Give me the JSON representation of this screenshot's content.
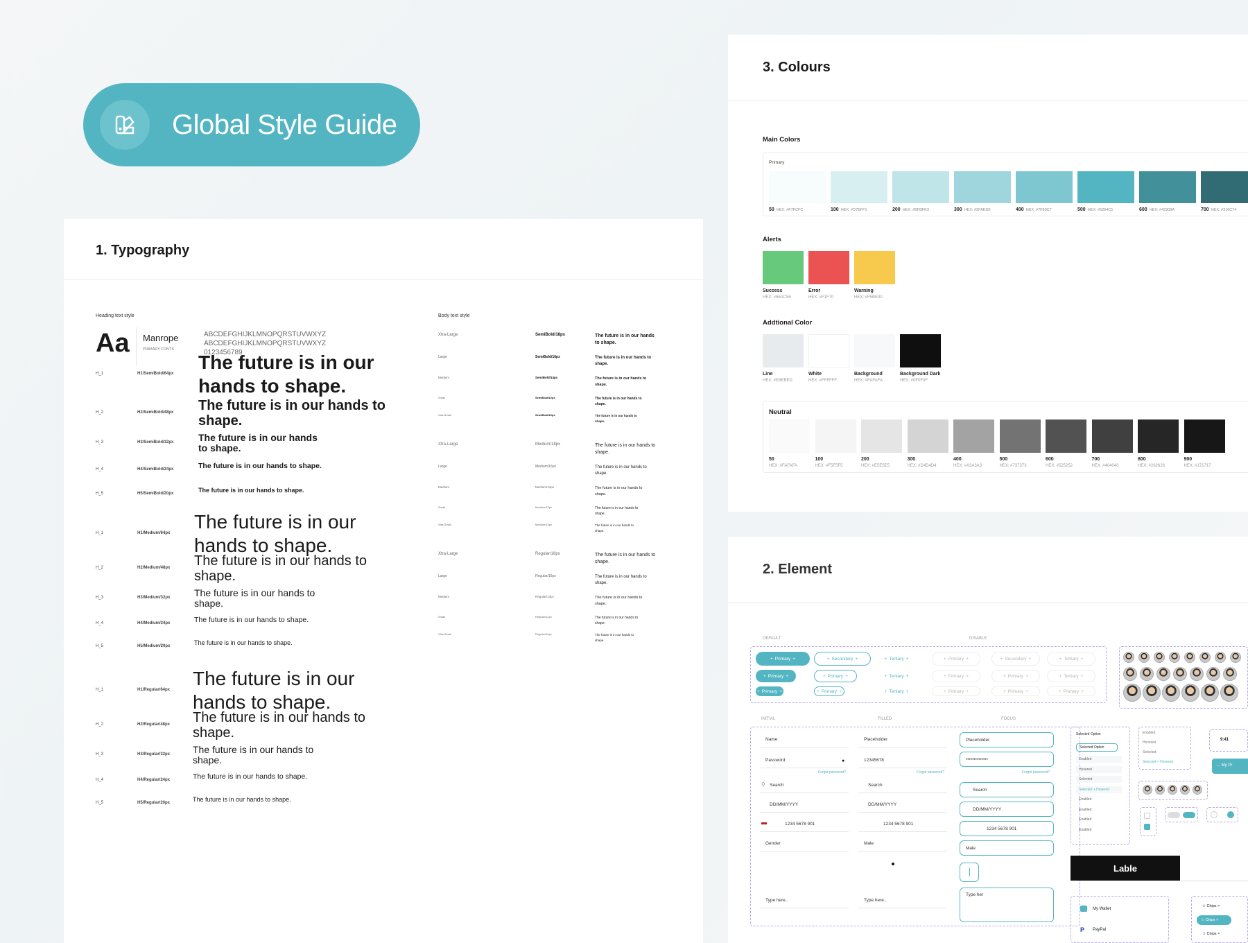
{
  "hero": {
    "title": "Global Style Guide",
    "icon": "palette-brush-icon"
  },
  "typography": {
    "title": "1. Typography",
    "heading_section": "Heading text style",
    "font_sample": "Aa",
    "font_name": "Manrope",
    "font_sub": "PRIMARY FONTS",
    "alphabet": [
      "ABCDEFGHIJKLMNOPQRSTUVWXYZ",
      "ABCDEFGHIJKLMNOPQRSTUVWXYZ",
      "0123456789"
    ],
    "sample": "The future is in our hands to shape.",
    "headings": [
      {
        "group": "SemiBold",
        "rows": [
          {
            "tag": "H_1",
            "spec": "H1/SemiBold/64px"
          },
          {
            "tag": "H_2",
            "spec": "H2/SemiBold/48px"
          },
          {
            "tag": "H_3",
            "spec": "H3/SemiBold/32px"
          },
          {
            "tag": "H_4",
            "spec": "H4/SemiBold/24px"
          },
          {
            "tag": "H_5",
            "spec": "H5/SemiBold/20px"
          }
        ]
      },
      {
        "group": "Medium",
        "rows": [
          {
            "tag": "H_1",
            "spec": "H1/Medium/64px"
          },
          {
            "tag": "H_2",
            "spec": "H2/Medium/48px"
          },
          {
            "tag": "H_3",
            "spec": "H3/Medium/32px"
          },
          {
            "tag": "H_4",
            "spec": "H4/Medium/24px"
          },
          {
            "tag": "H_5",
            "spec": "H5/Medium/20px"
          }
        ]
      },
      {
        "group": "Regular",
        "rows": [
          {
            "tag": "H_1",
            "spec": "H1/Regular/64px"
          },
          {
            "tag": "H_2",
            "spec": "H2/Regular/48px"
          },
          {
            "tag": "H_3",
            "spec": "H3/Regular/32px"
          },
          {
            "tag": "H_4",
            "spec": "H4/Regular/24px"
          },
          {
            "tag": "H_5",
            "spec": "H5/Regular/20px"
          }
        ]
      }
    ],
    "body_section": "Body text style",
    "body_groups": [
      {
        "rows": [
          {
            "size": "Xtra-Large",
            "spec": "SemiBold/18px"
          },
          {
            "size": "Large",
            "spec": "SemiBold/16px"
          },
          {
            "size": "Medium",
            "spec": "SemiBold/14px"
          },
          {
            "size": "Small",
            "spec": "SemiBold/12px"
          },
          {
            "size": "Xtra-Small",
            "spec": "SemiBold/10px"
          }
        ]
      },
      {
        "rows": [
          {
            "size": "Xtra-Large",
            "spec": "Medium/18px"
          },
          {
            "size": "Large",
            "spec": "Medium/16px"
          },
          {
            "size": "Medium",
            "spec": "Medium/14px"
          },
          {
            "size": "Small",
            "spec": "Medium/12px"
          },
          {
            "size": "Xtra-Small",
            "spec": "Medium/10px"
          }
        ]
      },
      {
        "rows": [
          {
            "size": "Xtra-Large",
            "spec": "Regular/18px"
          },
          {
            "size": "Large",
            "spec": "Regular/16px"
          },
          {
            "size": "Medium",
            "spec": "Regular/14px"
          },
          {
            "size": "Small",
            "spec": "Regular/12px"
          },
          {
            "size": "Xtra-Small",
            "spec": "Regular/10px"
          }
        ]
      }
    ]
  },
  "colours": {
    "title": "3. Colours",
    "main_label": "Main Colors",
    "primary_label": "Primary",
    "primary": [
      {
        "step": "50",
        "hex": "HEX: #F7FCFC",
        "color": "#f7fcfc"
      },
      {
        "step": "100",
        "hex": "HEX: #D7EFF1",
        "color": "#d7eff1"
      },
      {
        "step": "200",
        "hex": "HEX: #BFBFE3",
        "color": "#bfe5e9"
      },
      {
        "step": "300",
        "hex": "HEX: #9FAED5",
        "color": "#9fd5dc"
      },
      {
        "step": "400",
        "hex": "HEX: #7F80C7",
        "color": "#7fc7d0"
      },
      {
        "step": "500",
        "hex": "HEX: #5264C1",
        "color": "#54b5c2"
      },
      {
        "step": "600",
        "hex": "HEX: #42909A",
        "color": "#42909a"
      },
      {
        "step": "700",
        "hex": "HEX: #316C74",
        "color": "#316c74"
      }
    ],
    "alerts_label": "Alerts",
    "alerts": [
      {
        "name": "Success",
        "hex": "HEX: #66AC56",
        "color": "#66c97b"
      },
      {
        "name": "Error",
        "hex": "HEX: #F1F70",
        "color": "#eb5352"
      },
      {
        "name": "Warning",
        "hex": "HEX: #F5BE30",
        "color": "#f7c94c"
      }
    ],
    "additional_label": "Addtional Color",
    "additional": [
      {
        "name": "Line",
        "hex": "HEX: #E8EBED",
        "color": "#e8ebed"
      },
      {
        "name": "White",
        "hex": "HEX: #FFFFFF",
        "color": "#ffffff"
      },
      {
        "name": "Background",
        "hex": "HEX: #FAFAFA",
        "color": "#f7f8f9"
      },
      {
        "name": "Background Dark",
        "hex": "HEX: #0F0F0F",
        "color": "#0f0f0f"
      }
    ],
    "neutral_label": "Neutral",
    "neutral": [
      {
        "step": "50",
        "hex": "HEX: #FAFAFA",
        "color": "#fafafa"
      },
      {
        "step": "100",
        "hex": "HEX: #F5F5F5",
        "color": "#f5f5f5"
      },
      {
        "step": "200",
        "hex": "HEX: #E5E5E5",
        "color": "#e5e5e5"
      },
      {
        "step": "300",
        "hex": "HEX: #D4D4D4",
        "color": "#d4d4d4"
      },
      {
        "step": "400",
        "hex": "HEX: #A3A3A3",
        "color": "#a3a3a3"
      },
      {
        "step": "500",
        "hex": "HEX: #737373",
        "color": "#737373"
      },
      {
        "step": "600",
        "hex": "HEX: #525252",
        "color": "#525252"
      },
      {
        "step": "700",
        "hex": "HEX: #404040",
        "color": "#404040"
      },
      {
        "step": "800",
        "hex": "HEX: #262626",
        "color": "#262626"
      },
      {
        "step": "900",
        "hex": "HEX: #171717",
        "color": "#171717"
      }
    ]
  },
  "element": {
    "title": "2. Element",
    "default_label": "DEFAULT",
    "disable_label": "DISABLE",
    "buttons": {
      "primary": "Primary",
      "secondary": "Secondary",
      "tertiary": "Tertiary"
    },
    "initial_label": "INITIAL",
    "filled_label": "FILLED",
    "focus_label": "FOCUS",
    "fields": {
      "name": "Name",
      "placeholder": "Placeholder",
      "password": "Password",
      "password_value": "12345678",
      "password_dots": "••••••••••••••",
      "forgot": "Forgot password?",
      "search": "Search",
      "date": "DD/MM/YYYY",
      "country_code": "+1",
      "phone": "1234 5678 901",
      "gender": "Gender",
      "male": "Male",
      "type_here": "Type here..",
      "type_here_focus": "Type her"
    },
    "dropdown": {
      "selected": "Selected Option",
      "items": [
        "Enabled",
        "Hovered",
        "Selected",
        "Selected + Hovered",
        "Enabled",
        "Enabled",
        "Enabled",
        "Enabled"
      ]
    },
    "options": [
      "Enabled",
      "Hovered",
      "Selected",
      "Selected + Hovered"
    ],
    "time": "9:41",
    "nav_label": "My Pr",
    "label_button": "Lable",
    "wallet": [
      "My Wallet",
      "PayPal"
    ],
    "chips": [
      "Chips",
      "Chips",
      "Chips"
    ]
  }
}
